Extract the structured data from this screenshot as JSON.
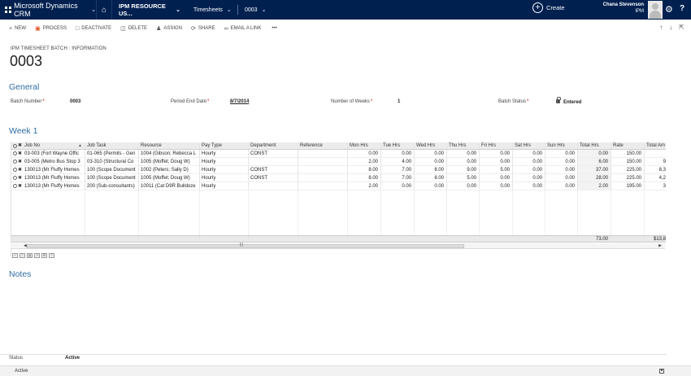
{
  "topnav": {
    "app_name": "Microsoft Dynamics CRM",
    "area": "IPM RESOURCE US...",
    "entity": "Timesheets",
    "record": "0003",
    "create_label": "Create",
    "user_name": "Chana Stevenson",
    "org": "IPM"
  },
  "commands": [
    "NEW",
    "PROCESS",
    "DEACTIVATE",
    "DELETE",
    "ASSIGN",
    "SHARE",
    "EMAIL A LINK",
    "•••"
  ],
  "header": {
    "entity_name": "IPM TIMESHEET BATCH : INFORMATION",
    "title": "0003"
  },
  "general": {
    "title": "General",
    "batch_number_label": "Batch Number",
    "batch_number": "0003",
    "period_end_label": "Period End Date",
    "period_end": "8/7/2014",
    "weeks_label": "Number of Weeks",
    "weeks": "1",
    "status_label": "Batch Status",
    "status": "Entered"
  },
  "week": {
    "title": "Week 1",
    "columns": [
      "Job No",
      "Job Task",
      "Resource",
      "Pay Type",
      "Department",
      "Reference",
      "Mon Hrs",
      "Tue Hrs",
      "Wed Hrs",
      "Thu Hrs",
      "Fri Hrs",
      "Sat Hrs",
      "Sun Hrs",
      "Total Hrs",
      "Rate",
      "Total Am"
    ],
    "rows": [
      [
        "03-003 (Fort Wayne Offic",
        "01-065 (Permits - Gen",
        "1004 (Gibson; Rebecca L",
        "Hourly",
        "CONST",
        "",
        "0.00",
        "0.00",
        "0.00",
        "0.00",
        "0.00",
        "0.00",
        "0.00",
        "0.00",
        "150.00",
        ""
      ],
      [
        "03-005 (Metro Bus Stop 3",
        "03-310 (Structural Co",
        "1005 (Moffet; Doug W)",
        "Hourly",
        "",
        "",
        "2.00",
        "4.00",
        "0.00",
        "0.00",
        "0.00",
        "0.00",
        "0.00",
        "6.00",
        "150.00",
        "9"
      ],
      [
        "130013 (Mr Fluffy Homes",
        "100 (Scope Document",
        "1002 (Peters; Sally D)",
        "Hourly",
        "CONST",
        "",
        "8.00",
        "7.00",
        "8.00",
        "9.00",
        "5.00",
        "0.00",
        "0.00",
        "37.00",
        "225.00",
        "8,3"
      ],
      [
        "130013 (Mr Fluffy Homes",
        "100 (Scope Document",
        "1005 (Moffet; Doug W)",
        "Hourly",
        "CONST",
        "",
        "8.00",
        "7.00",
        "8.00",
        "5.00",
        "0.00",
        "0.00",
        "0.00",
        "28.00",
        "225.00",
        "4,2"
      ],
      [
        "130013 (Mr Fluffy Homes",
        "200 (Sub-consultants)",
        "10011 (Cat D9R Bulldoze",
        "Hourly",
        "",
        "",
        "2.00",
        "0.00",
        "0.00",
        "0.00",
        "0.00",
        "0.00",
        "0.00",
        "2.00",
        "195.00",
        "3"
      ]
    ],
    "total_hrs": "73.00",
    "total_amount": "$13,8"
  },
  "notes": {
    "title": "Notes"
  },
  "footer": {
    "status_label": "Status",
    "status_value": "Active",
    "bar_text": "Active"
  }
}
